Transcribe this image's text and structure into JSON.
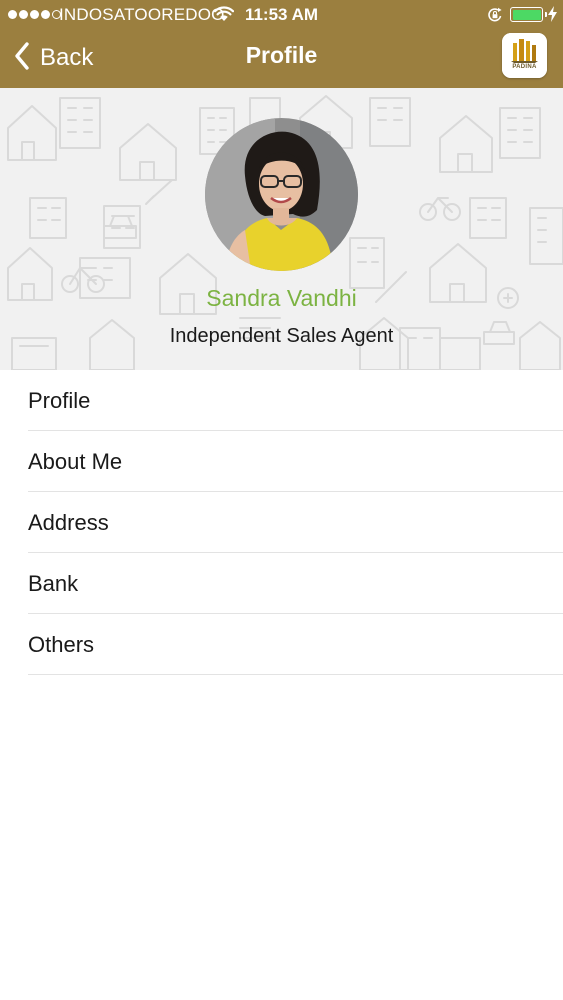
{
  "status_bar": {
    "carrier": "INDOSATOOREDOO",
    "time": "11:53 AM",
    "signal_bars_filled": 4,
    "signal_bars_total": 5
  },
  "nav": {
    "back_label": "Back",
    "title": "Profile",
    "logo_text": "PADINA"
  },
  "profile": {
    "name": "Sandra Vandhi",
    "role": "Independent Sales Agent"
  },
  "menu": {
    "items": [
      {
        "label": "Profile"
      },
      {
        "label": "About Me"
      },
      {
        "label": "Address"
      },
      {
        "label": "Bank"
      },
      {
        "label": "Others"
      }
    ]
  },
  "colors": {
    "header_bg": "#9b7f3f",
    "name_accent": "#7cb342",
    "battery": "#4cd964",
    "banner_bg": "#f1f1f1"
  }
}
